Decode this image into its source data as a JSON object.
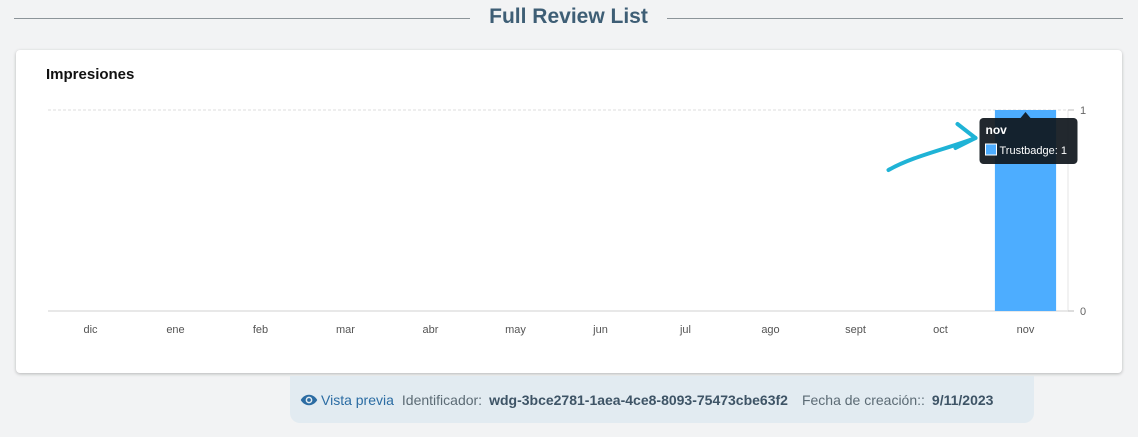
{
  "page": {
    "title": "Full Review List"
  },
  "chart_data": {
    "type": "bar",
    "title": "Impresiones",
    "categories": [
      "dic",
      "ene",
      "feb",
      "mar",
      "abr",
      "may",
      "jun",
      "jul",
      "ago",
      "sept",
      "oct",
      "nov"
    ],
    "series": [
      {
        "name": "Trustbadge",
        "values": [
          0,
          0,
          0,
          0,
          0,
          0,
          0,
          0,
          0,
          0,
          0,
          1
        ],
        "color": "#4dadff"
      }
    ],
    "ylim": [
      0,
      1
    ],
    "yticks": [
      "0",
      "1"
    ],
    "y_axis_side": "right",
    "grid": true,
    "tooltip": {
      "category": "nov",
      "series": "Trustbadge",
      "text": "Trustbadge: 1"
    },
    "annotation_arrow_color": "#1fb3d6"
  },
  "footer": {
    "preview_label": "Vista previa",
    "id_label": "Identificador:",
    "id_value": "wdg-3bce2781-1aea-4ce8-8093-75473cbe63f2",
    "date_label": "Fecha de creación::",
    "date_value": "9/11/2023"
  }
}
